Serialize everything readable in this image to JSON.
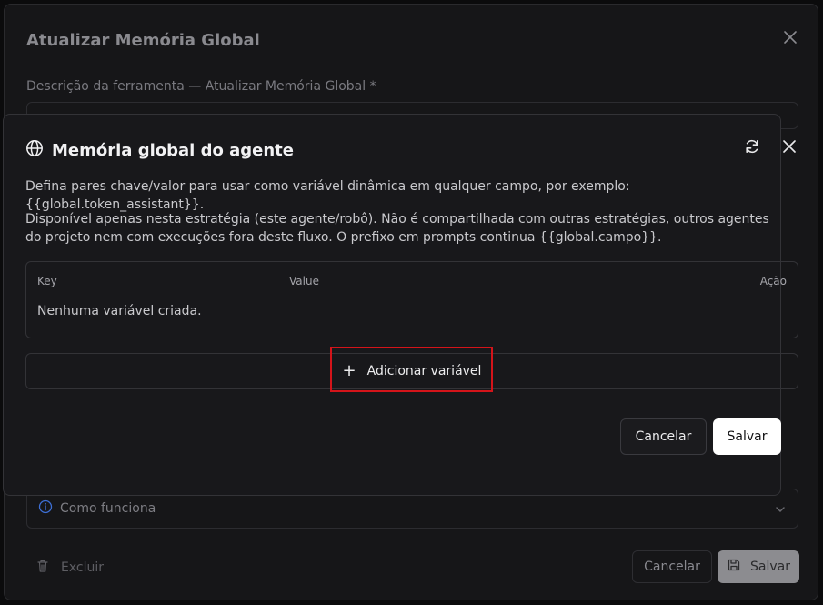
{
  "background_dialog": {
    "title": "Atualizar Memória Global",
    "description_label": "Descrição da ferramenta — Atualizar Memória Global *",
    "accordion_label": "Como funciona",
    "delete_label": "Excluir",
    "cancel_label": "Cancelar",
    "save_label": "Salvar"
  },
  "modal": {
    "title": "Memória global do agente",
    "paragraph_1": "Defina pares chave/valor para usar como variável dinâmica em qualquer campo, por exemplo: {{global.token_assistant}}.",
    "paragraph_2": "Disponível apenas nesta estratégia (este agente/robô). Não é compartilhada com outras estratégias, outros agentes do projeto nem com execuções fora deste fluxo. O prefixo em prompts continua {{global.campo}}.",
    "table": {
      "columns": [
        "Key",
        "Value",
        "Ação"
      ],
      "empty_message": "Nenhuma variável criada."
    },
    "add_variable_label": "Adicionar variável",
    "cancel_label": "Cancelar",
    "save_label": "Salvar"
  },
  "colors": {
    "highlight": "#d4141a",
    "modal_bg": "#18181b",
    "primary_button": "#ffffff"
  }
}
